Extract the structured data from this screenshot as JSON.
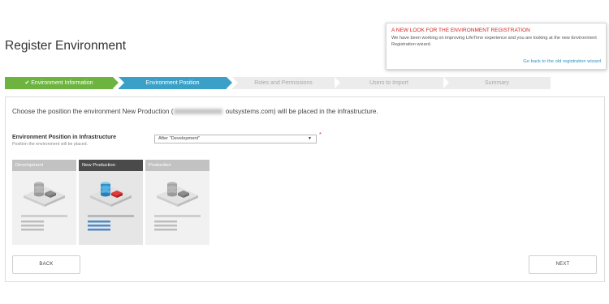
{
  "page": {
    "title": "Register Environment"
  },
  "notice": {
    "title": "A NEW LOOK FOR THE ENVIRONMENT REGISTRATION",
    "body": "We have been working on improving LifeTime experience and you are looking at the new Environment Registration wizard.",
    "link": "Go back to the old registration wizard"
  },
  "wizard": {
    "steps": [
      {
        "label": "✔ Environment Information",
        "state": "done"
      },
      {
        "label": "Environment Position",
        "state": "active"
      },
      {
        "label": "Roles and Permissions",
        "state": "todo"
      },
      {
        "label": "Users to Import",
        "state": "todo"
      },
      {
        "label": "Summary",
        "state": "todo"
      }
    ],
    "colors": {
      "done": "#6cb33f",
      "active": "#3aa0c8",
      "todo": "#ececec"
    }
  },
  "main": {
    "intro_before": "Choose the position the environment New Production (",
    "intro_after": "outsystems.com) will be placed in the infrastructure.",
    "field_label": "Environment Position in Infrastructure",
    "field_help": "Position the environment will be placed.",
    "select_value": "After \"Development\"",
    "required_mark": "*"
  },
  "environments": [
    {
      "name": "Development",
      "selected": false
    },
    {
      "name": "New Production",
      "selected": true
    },
    {
      "name": "Production",
      "selected": false
    }
  ],
  "buttons": {
    "back": "BACK",
    "next": "NEXT"
  },
  "icons": {
    "database": "database-stack-icon",
    "server_badge": "server-badge-icon"
  }
}
